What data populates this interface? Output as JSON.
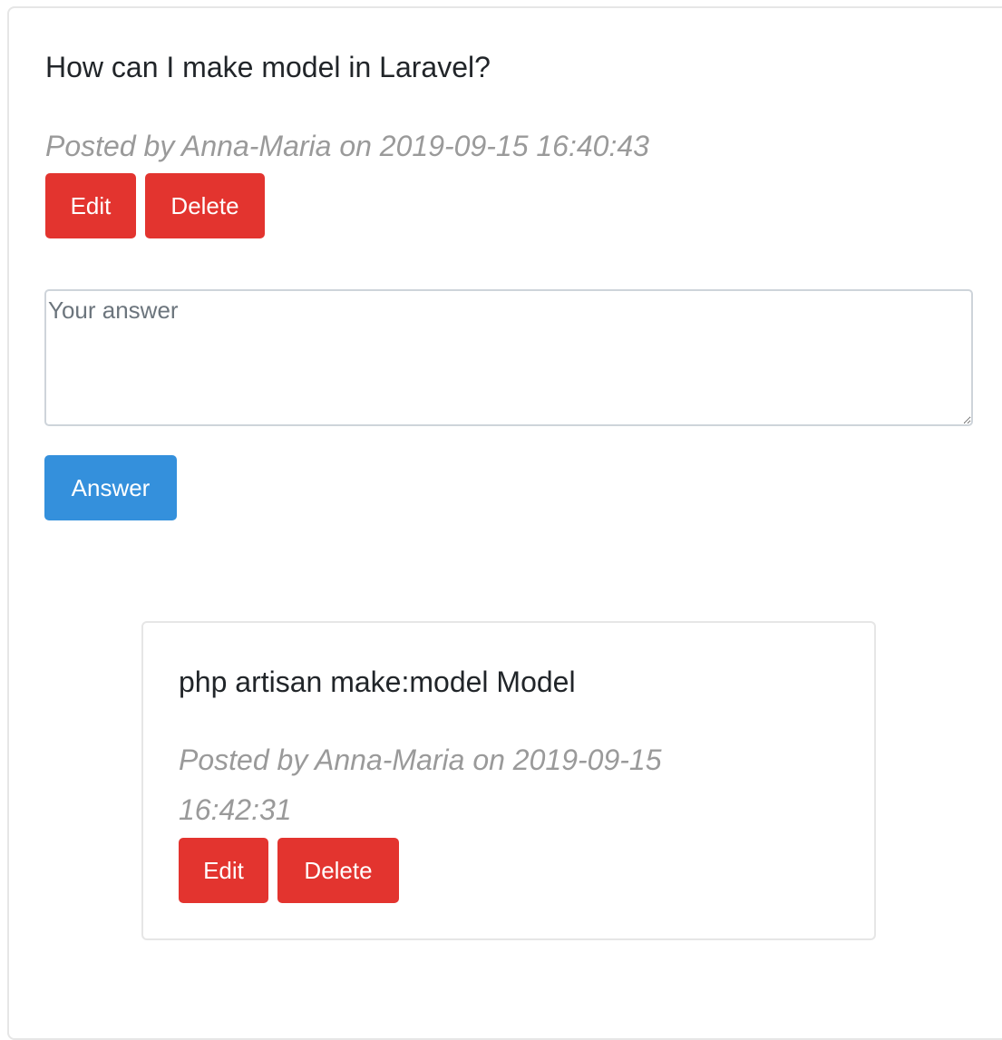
{
  "question": {
    "title": "How can I make model in Laravel?",
    "meta": "Posted by Anna-Maria on 2019-09-15 16:40:43",
    "edit_label": "Edit",
    "delete_label": "Delete"
  },
  "answer_form": {
    "placeholder": "Your answer",
    "value": "",
    "submit_label": "Answer"
  },
  "answers": [
    {
      "text": "php artisan make:model Model",
      "meta": "Posted by Anna-Maria on 2019-09-15 16:42:31",
      "edit_label": "Edit",
      "delete_label": "Delete"
    }
  ],
  "colors": {
    "danger": "#e3342f",
    "primary": "#3490dc",
    "muted_text": "#9a9a9a",
    "border": "#e6e6e6"
  }
}
